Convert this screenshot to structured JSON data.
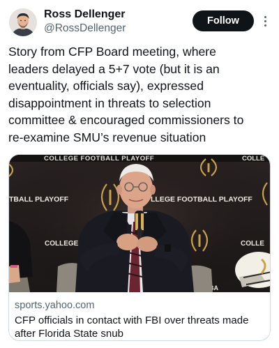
{
  "author": {
    "name": "Ross Dellenger",
    "handle": "@RossDellenger"
  },
  "follow_label": "Follow",
  "tweet": {
    "text": "Story from CFP Board meeting, where\nleaders delayed a 5+7 vote (but it is an\neventuality, officials say), expressed\ndisappointment in threats to selection\ncommittee & encouraged commissioners to\nre-examine SMU’s revenue situation"
  },
  "link_card": {
    "domain": "sports.yahoo.com",
    "title": "CFP officials in contact with FBI over threats made after Florida State snub",
    "image_signage": {
      "top_banner": "COLLEGE FOOTBALL PLAYOFF",
      "top_banner_right": "COLLE",
      "left_banner": "TBALL PLAYOFF",
      "right_banner": "LLEGE FOOTBALL PLAYOFF",
      "left_mid": "COLLEGE",
      "right_mid": "COLLE",
      "bottom_right": "BA"
    }
  },
  "colors": {
    "follow_bg": "#0f1419",
    "secondary_text": "#536471",
    "card_border": "#cfd9de",
    "backdrop": "#2a2424",
    "logo_gold": "#c9a14a"
  },
  "icons": {
    "more": "more-vertical-icon"
  }
}
